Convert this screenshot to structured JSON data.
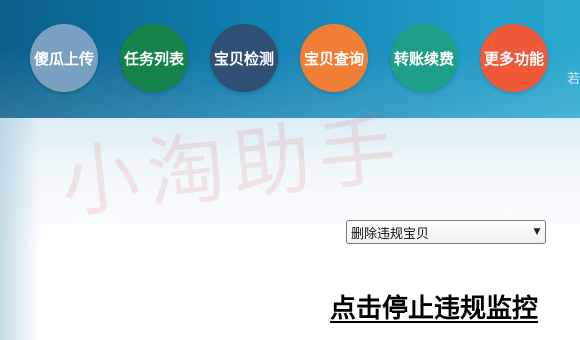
{
  "nav": {
    "items": [
      {
        "label": "傻瓜上传",
        "color": "#7aa0c1"
      },
      {
        "label": "任务列表",
        "color": "#16834a"
      },
      {
        "label": "宝贝检测",
        "color": "#2f4f74"
      },
      {
        "label": "宝贝查询",
        "color": "#f07f35"
      },
      {
        "label": "转账续费",
        "color": "#1d9f88"
      },
      {
        "label": "更多功能",
        "color": "#f05a3b"
      }
    ],
    "right_partial_text": "若"
  },
  "watermark": {
    "text": "小淘助手"
  },
  "action_select": {
    "selected": "删除违规宝贝"
  },
  "stop_link": {
    "label": "点击停止违规监控"
  }
}
